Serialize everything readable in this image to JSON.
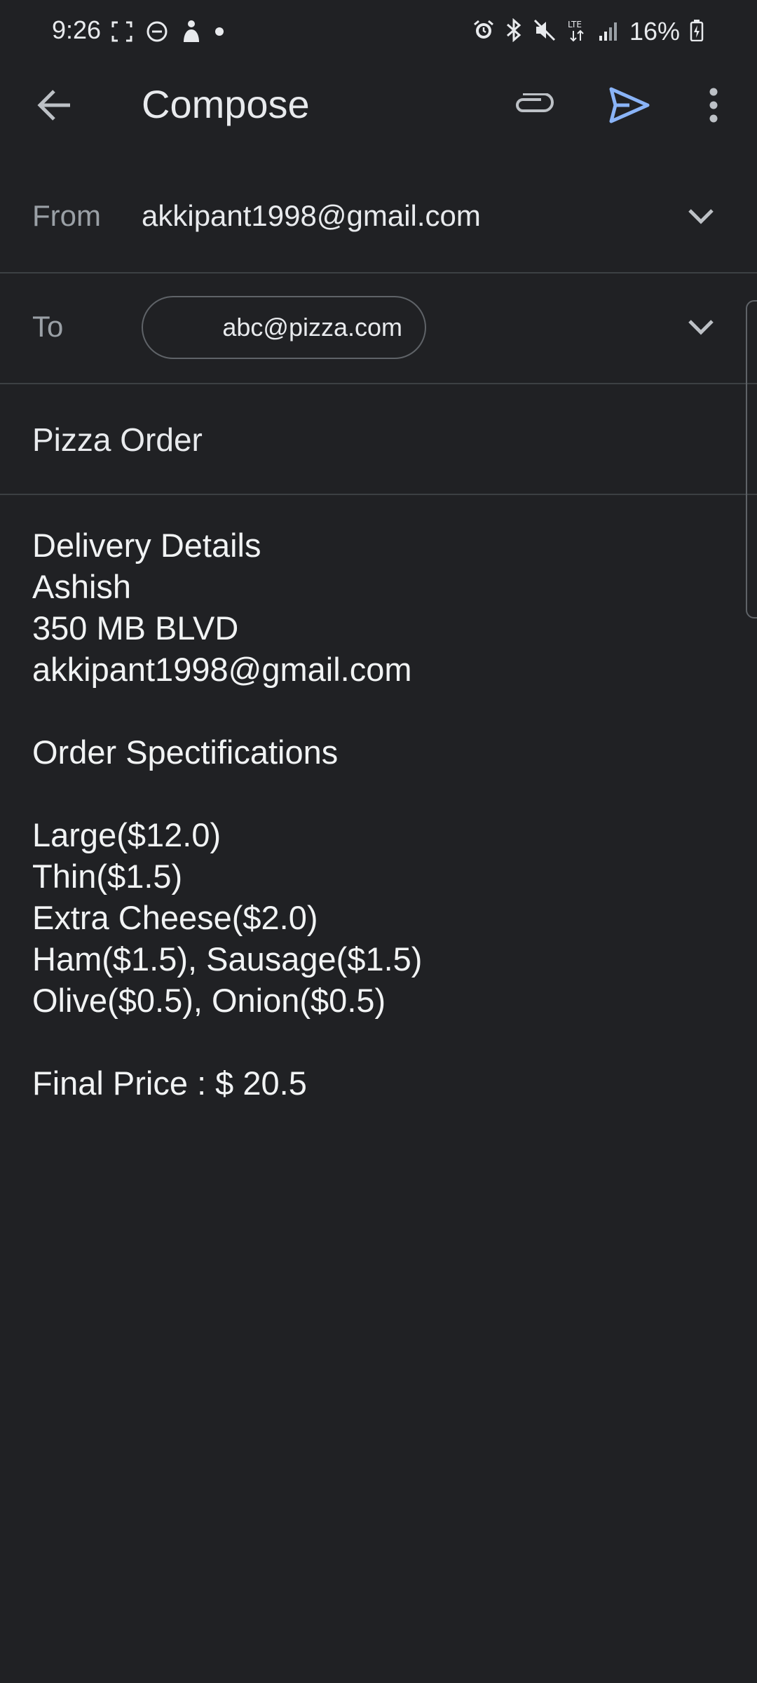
{
  "status_bar": {
    "time": "9:26",
    "battery_percent": "16%",
    "left_icons": [
      "screenshot-icon",
      "do-not-disturb-icon",
      "accessibility-icon",
      "notification-dot-icon"
    ],
    "right_icons": [
      "alarm-icon",
      "bluetooth-icon",
      "mute-icon",
      "lte-icon",
      "signal-icon",
      "battery-charging-icon"
    ]
  },
  "app_bar": {
    "title": "Compose",
    "send_color": "#8ab4f8"
  },
  "from": {
    "label": "From",
    "value": "akkipant1998@gmail.com"
  },
  "to": {
    "label": "To",
    "chip": "abc@pizza.com"
  },
  "subject": {
    "value": "Pizza Order"
  },
  "body": {
    "lines": [
      "Delivery Details",
      "Ashish",
      "350 MB BLVD",
      "akkipant1998@gmail.com",
      "",
      "Order Spectifications",
      "",
      "Large($12.0)",
      "Thin($1.5)",
      "Extra Cheese($2.0)",
      "Ham($1.5), Sausage($1.5)",
      "Olive($0.5), Onion($0.5)",
      "",
      "Final Price : $ 20.5"
    ]
  }
}
